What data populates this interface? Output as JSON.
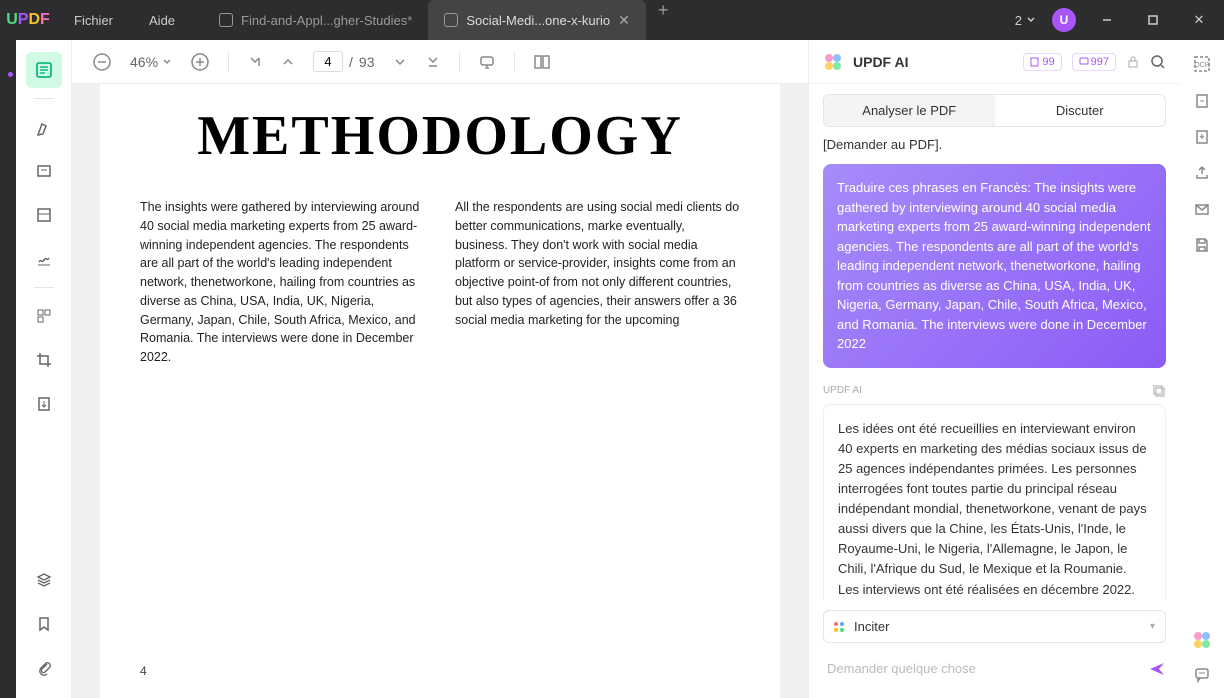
{
  "app": {
    "brand": "UPDF"
  },
  "menu": {
    "file": "Fichier",
    "help": "Aide"
  },
  "tabs": {
    "inactive": "Find-and-Appl...gher-Studies*",
    "active": "Social-Medi...one-x-kurio"
  },
  "titlebar": {
    "notif_count": "2",
    "avatar_letter": "U"
  },
  "toolbar": {
    "zoom_pct": "46%",
    "current_page": "4",
    "total_pages": "93",
    "page_sep": "/"
  },
  "doc": {
    "heading": "METHODOLOGY",
    "col1": "The insights were gathered by interviewing around 40 social media marketing experts from 25 award-winning independent agencies. The respondents are all part of the world's leading independent network, thenetworkone, hailing from countries as diverse as China, USA, India, UK, Nigeria, Germany, Japan, Chile, South Africa, Mexico, and Romania. The interviews were done in December 2022.",
    "col2": "All the respondents are using social medi clients do better communications, marke eventually, business. They don't work with social media platform or service-provider, insights come from an objective point-of from not only different countries, but also types of agencies, their answers offer a 36 social media marketing for the upcoming",
    "page_number": "4"
  },
  "ai": {
    "title": "UPDF AI",
    "badge1": "99",
    "badge2": "997",
    "tab_analyze": "Analyser le PDF",
    "tab_chat": "Discuter",
    "sys_note": "[Demander au PDF].",
    "user_msg": "Traduire ces phrases en Francès: The insights were gathered by interviewing around 40 social media marketing experts from 25 award-winning independent agencies. The respondents are all part of the world's leading independent network, thenetworkone, hailing from countries as diverse as China, USA, India, UK, Nigeria, Germany, Japan, Chile, South Africa, Mexico, and Romania. The interviews were done in December 2022",
    "ai_label": "UPDF AI",
    "ai_msg": "Les idées ont été recueillies en interviewant environ 40 experts en marketing des médias sociaux issus de 25 agences indépendantes primées. Les personnes interrogées font toutes partie du principal réseau indépendant mondial, thenetworkone, venant de pays aussi divers que la Chine, les États-Unis, l'Inde, le Royaume-Uni, le Nigeria, l'Allemagne, le Japon, le Chili, l'Afrique du Sud, le Mexique et la Roumanie. Les interviews ont été réalisées en décembre 2022.",
    "suggest_label": "Inciter",
    "input_placeholder": "Demander quelque chose"
  }
}
